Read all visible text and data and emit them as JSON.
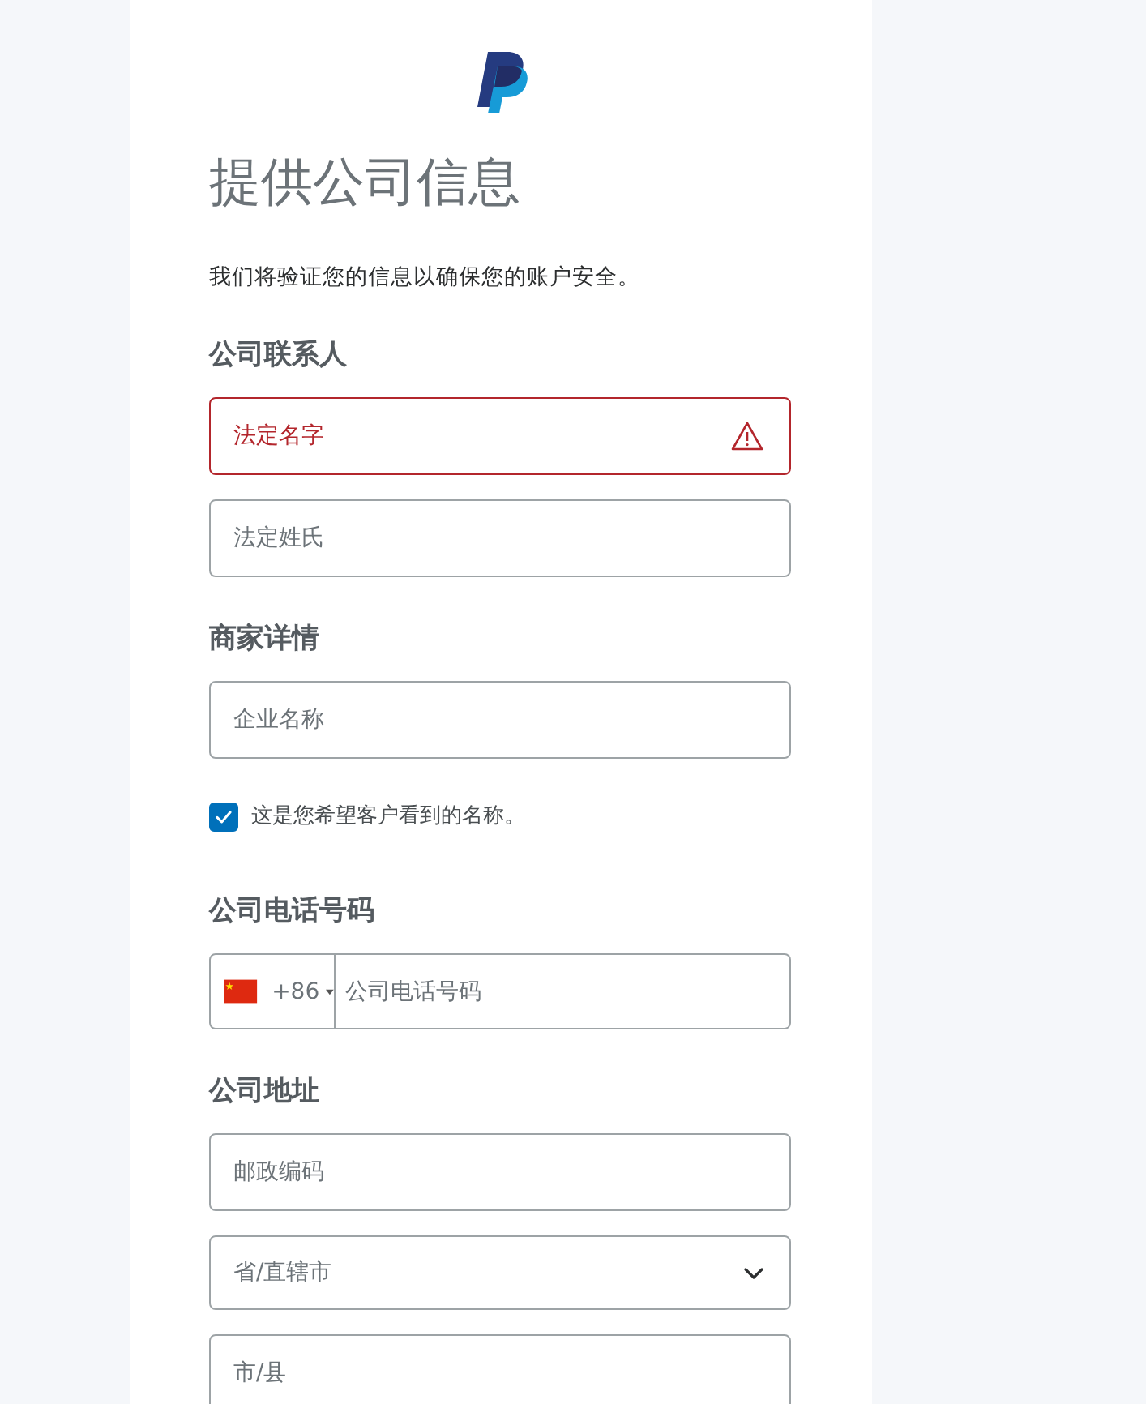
{
  "title": "提供公司信息",
  "subtitle": "我们将验证您的信息以确保您的账户安全。",
  "sections": [
    {
      "heading": "公司联系人",
      "fields": [
        {
          "kind": "text",
          "placeholder": "法定名字",
          "error": true
        },
        {
          "kind": "text",
          "placeholder": "法定姓氏",
          "error": false
        }
      ]
    },
    {
      "heading": "商家详情",
      "fields": [
        {
          "kind": "text",
          "placeholder": "企业名称",
          "error": false
        },
        {
          "kind": "checkbox",
          "label": "这是您希望客户看到的名称。",
          "checked": true
        }
      ]
    },
    {
      "heading": "公司电话号码",
      "fields": [
        {
          "kind": "phone",
          "country_code": "+86",
          "placeholder": "公司电话号码",
          "error": false
        }
      ]
    },
    {
      "heading": "公司地址",
      "fields": [
        {
          "kind": "text",
          "placeholder": "邮政编码",
          "error": false
        },
        {
          "kind": "select",
          "placeholder": "省/直辖市",
          "error": false
        },
        {
          "kind": "text",
          "placeholder": "市/县",
          "error": false
        }
      ]
    }
  ]
}
